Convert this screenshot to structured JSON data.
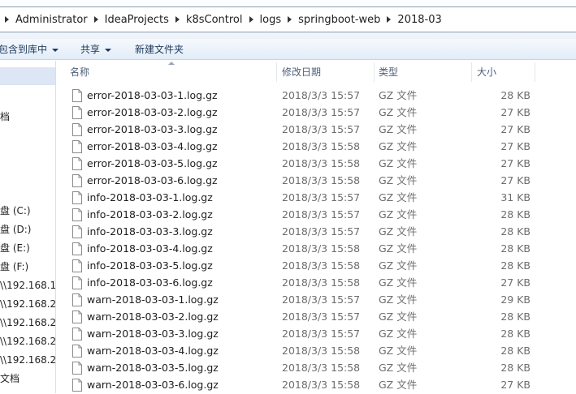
{
  "breadcrumb": [
    "Administrator",
    "IdeaProjects",
    "k8sControl",
    "logs",
    "springboot-web",
    "2018-03"
  ],
  "toolbar": {
    "include_library": "包含到库中",
    "share": "共享",
    "new_folder": "新建文件夹"
  },
  "nav": {
    "items": [
      "档",
      "盘 (C:)",
      "盘 (D:)",
      "盘 (E:)",
      "盘 (F:)",
      "\\\\192.168.1",
      "\\\\192.168.2",
      "\\\\192.168.2",
      "\\\\192.168.2",
      "\\\\192.168.2",
      "文档"
    ]
  },
  "columns": {
    "name": "名称",
    "modified": "修改日期",
    "type": "类型",
    "size": "大小"
  },
  "files": [
    {
      "name": "error-2018-03-03-1.log.gz",
      "modified": "2018/3/3 15:57",
      "type": "GZ 文件",
      "size": "28 KB"
    },
    {
      "name": "error-2018-03-03-2.log.gz",
      "modified": "2018/3/3 15:57",
      "type": "GZ 文件",
      "size": "27 KB"
    },
    {
      "name": "error-2018-03-03-3.log.gz",
      "modified": "2018/3/3 15:57",
      "type": "GZ 文件",
      "size": "27 KB"
    },
    {
      "name": "error-2018-03-03-4.log.gz",
      "modified": "2018/3/3 15:58",
      "type": "GZ 文件",
      "size": "27 KB"
    },
    {
      "name": "error-2018-03-03-5.log.gz",
      "modified": "2018/3/3 15:58",
      "type": "GZ 文件",
      "size": "27 KB"
    },
    {
      "name": "error-2018-03-03-6.log.gz",
      "modified": "2018/3/3 15:58",
      "type": "GZ 文件",
      "size": "27 KB"
    },
    {
      "name": "info-2018-03-03-1.log.gz",
      "modified": "2018/3/3 15:57",
      "type": "GZ 文件",
      "size": "31 KB"
    },
    {
      "name": "info-2018-03-03-2.log.gz",
      "modified": "2018/3/3 15:57",
      "type": "GZ 文件",
      "size": "28 KB"
    },
    {
      "name": "info-2018-03-03-3.log.gz",
      "modified": "2018/3/3 15:57",
      "type": "GZ 文件",
      "size": "28 KB"
    },
    {
      "name": "info-2018-03-03-4.log.gz",
      "modified": "2018/3/3 15:58",
      "type": "GZ 文件",
      "size": "28 KB"
    },
    {
      "name": "info-2018-03-03-5.log.gz",
      "modified": "2018/3/3 15:58",
      "type": "GZ 文件",
      "size": "28 KB"
    },
    {
      "name": "info-2018-03-03-6.log.gz",
      "modified": "2018/3/3 15:58",
      "type": "GZ 文件",
      "size": "27 KB"
    },
    {
      "name": "warn-2018-03-03-1.log.gz",
      "modified": "2018/3/3 15:57",
      "type": "GZ 文件",
      "size": "29 KB"
    },
    {
      "name": "warn-2018-03-03-2.log.gz",
      "modified": "2018/3/3 15:57",
      "type": "GZ 文件",
      "size": "28 KB"
    },
    {
      "name": "warn-2018-03-03-3.log.gz",
      "modified": "2018/3/3 15:57",
      "type": "GZ 文件",
      "size": "28 KB"
    },
    {
      "name": "warn-2018-03-03-4.log.gz",
      "modified": "2018/3/3 15:58",
      "type": "GZ 文件",
      "size": "28 KB"
    },
    {
      "name": "warn-2018-03-03-5.log.gz",
      "modified": "2018/3/3 15:58",
      "type": "GZ 文件",
      "size": "28 KB"
    },
    {
      "name": "warn-2018-03-03-6.log.gz",
      "modified": "2018/3/3 15:58",
      "type": "GZ 文件",
      "size": "27 KB"
    }
  ],
  "icons": {
    "file": "file-icon",
    "separator": "chevron-right-icon",
    "dropdown": "chevron-down-icon"
  }
}
